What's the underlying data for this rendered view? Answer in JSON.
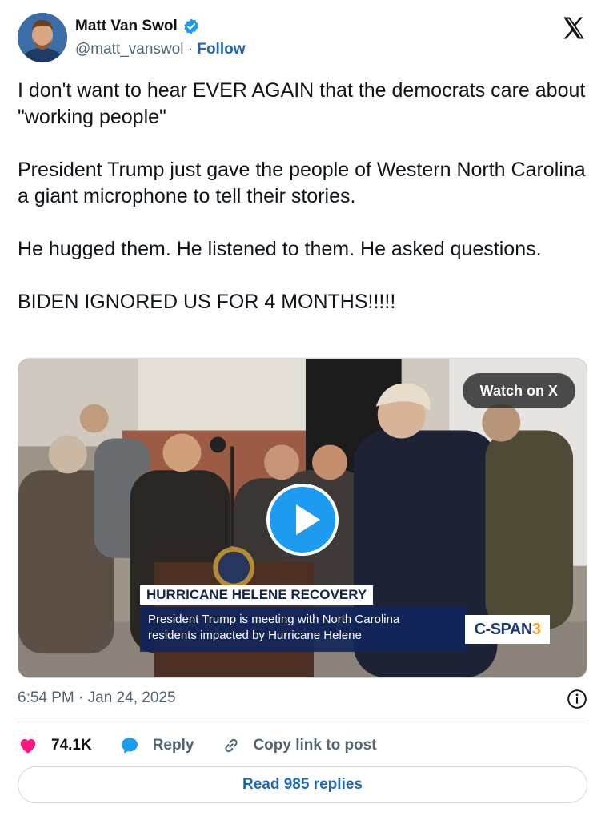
{
  "author": {
    "name": "Matt Van Swol",
    "handle": "@matt_vanswol",
    "separator": "·",
    "follow_label": "Follow",
    "verified": true
  },
  "tweet": {
    "paragraphs": [
      "I don't want to hear EVER AGAIN that the democrats care about \"working people\"",
      "President Trump just gave the people of Western North Carolina a giant microphone to tell their stories.",
      "He hugged them. He listened to them. He asked questions.",
      "BIDEN IGNORED US FOR 4 MONTHS!!!!!"
    ]
  },
  "media": {
    "watch_label": "Watch on X",
    "chyron_title": "HURRICANE HELENE RECOVERY",
    "chyron_line1": "President Trump is meeting with North Carolina",
    "chyron_line2": "residents impacted by Hurricane Helene",
    "network_text": "C-SPAN",
    "network_number": "3"
  },
  "meta": {
    "timestamp": "6:54 PM · Jan 24, 2025"
  },
  "actions": {
    "likes": "74.1K",
    "reply_label": "Reply",
    "copy_label": "Copy link to post"
  },
  "read_replies_label": "Read 985 replies",
  "colors": {
    "accent": "#1d9bf0",
    "link": "#1d67b5",
    "heart": "#f91880",
    "muted": "#536471"
  },
  "icons": [
    "verified-badge-icon",
    "x-logo-icon",
    "play-icon",
    "info-icon",
    "heart-icon",
    "reply-bubble-icon",
    "link-icon"
  ]
}
